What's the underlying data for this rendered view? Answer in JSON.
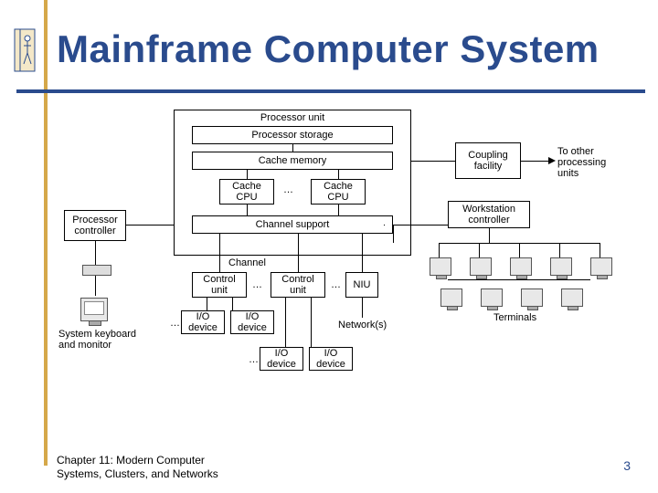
{
  "title": "Mainframe Computer System",
  "footer": {
    "left_line1": "Chapter 11: Modern Computer",
    "left_line2": "Systems, Clusters, and Networks",
    "page": "3"
  },
  "diagram": {
    "processor_unit": "Processor unit",
    "processor_storage": "Processor storage",
    "cache_memory": "Cache memory",
    "cache_cpu_1": "Cache CPU",
    "cache_cpu_2": "Cache CPU",
    "channel_support": "Channel support",
    "coupling_facility": "Coupling facility",
    "to_other_units_l1": "To other",
    "to_other_units_l2": "processing",
    "to_other_units_l3": "units",
    "workstation_controller": "Workstation controller",
    "processor_controller": "Processor controller",
    "channel": "Channel",
    "control_unit_1": "Control unit",
    "control_unit_2": "Control unit",
    "niu": "NIU",
    "io_device_1": "I/O device",
    "io_device_2": "I/O device",
    "io_device_3": "I/O device",
    "io_device_4": "I/O device",
    "networks": "Network(s)",
    "terminals": "Terminals",
    "sys_kbd_mon_l1": "System keyboard",
    "sys_kbd_mon_l2": "and monitor"
  }
}
